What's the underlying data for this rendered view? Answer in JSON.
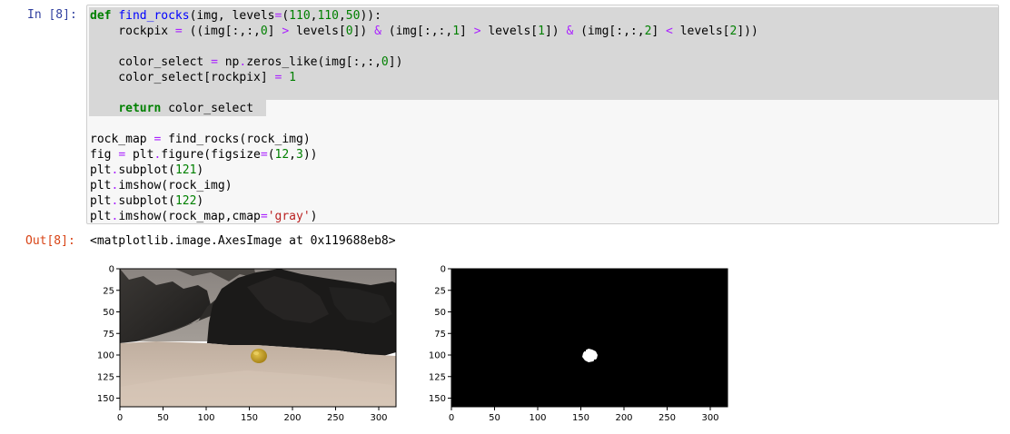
{
  "cell": {
    "in_prompt": "In [8]:",
    "out_prompt": "Out[8]:",
    "output_text": "<matplotlib.image.AxesImage at 0x119688eb8>"
  },
  "code": {
    "lines": [
      [
        [
          "kw",
          "def"
        ],
        [
          "",
          ""
        ],
        [
          "txt",
          " "
        ],
        [
          "nf",
          "find_rocks"
        ],
        [
          "txt",
          "(img, levels"
        ],
        [
          "op",
          "="
        ],
        [
          "txt",
          "("
        ],
        [
          "num",
          "110"
        ],
        [
          "txt",
          ","
        ],
        [
          "num",
          "110"
        ],
        [
          "txt",
          ","
        ],
        [
          "num",
          "50"
        ],
        [
          "txt",
          "))"
        ],
        [
          "txt",
          ":"
        ]
      ],
      [
        [
          "txt",
          "    rockpix "
        ],
        [
          "op",
          "="
        ],
        [
          "txt",
          " ((img[:,:,"
        ],
        [
          "num",
          "0"
        ],
        [
          "txt",
          "] "
        ],
        [
          "op",
          ">"
        ],
        [
          "txt",
          " levels["
        ],
        [
          "num",
          "0"
        ],
        [
          "txt",
          "]) "
        ],
        [
          "op",
          "&"
        ],
        [
          "txt",
          " (img[:,:,"
        ],
        [
          "num",
          "1"
        ],
        [
          "txt",
          "] "
        ],
        [
          "op",
          ">"
        ],
        [
          "txt",
          " levels["
        ],
        [
          "num",
          "1"
        ],
        [
          "txt",
          "]) "
        ],
        [
          "op",
          "&"
        ],
        [
          "txt",
          " (img[:,:,"
        ],
        [
          "num",
          "2"
        ],
        [
          "txt",
          "] "
        ],
        [
          "op",
          "<"
        ],
        [
          "txt",
          " levels["
        ],
        [
          "num",
          "2"
        ],
        [
          "txt",
          "]))"
        ]
      ],
      [
        [
          "txt",
          ""
        ]
      ],
      [
        [
          "txt",
          "    color_select "
        ],
        [
          "op",
          "="
        ],
        [
          "txt",
          " np"
        ],
        [
          "op",
          "."
        ],
        [
          "txt",
          "zeros_like(img[:,:,"
        ],
        [
          "num",
          "0"
        ],
        [
          "txt",
          "])"
        ]
      ],
      [
        [
          "txt",
          "    color_select[rockpix] "
        ],
        [
          "op",
          "="
        ],
        [
          "txt",
          " "
        ],
        [
          "num",
          "1"
        ]
      ],
      [
        [
          "txt",
          ""
        ]
      ],
      [
        [
          "txt",
          "    "
        ],
        [
          "kw",
          "return"
        ],
        [
          "txt",
          " color_select"
        ]
      ],
      [
        [
          "txt",
          ""
        ]
      ],
      [
        [
          "txt",
          "rock_map "
        ],
        [
          "op",
          "="
        ],
        [
          "txt",
          " find_rocks(rock_img)"
        ]
      ],
      [
        [
          "txt",
          "fig "
        ],
        [
          "op",
          "="
        ],
        [
          "txt",
          " plt"
        ],
        [
          "op",
          "."
        ],
        [
          "txt",
          "figure(figsize"
        ],
        [
          "op",
          "="
        ],
        [
          "txt",
          "("
        ],
        [
          "num",
          "12"
        ],
        [
          "txt",
          ","
        ],
        [
          "num",
          "3"
        ],
        [
          "txt",
          "))"
        ]
      ],
      [
        [
          "txt",
          "plt"
        ],
        [
          "op",
          "."
        ],
        [
          "txt",
          "subplot("
        ],
        [
          "num",
          "121"
        ],
        [
          "txt",
          ")"
        ]
      ],
      [
        [
          "txt",
          "plt"
        ],
        [
          "op",
          "."
        ],
        [
          "txt",
          "imshow(rock_img)"
        ]
      ],
      [
        [
          "txt",
          "plt"
        ],
        [
          "op",
          "."
        ],
        [
          "txt",
          "subplot("
        ],
        [
          "num",
          "122"
        ],
        [
          "txt",
          ")"
        ]
      ],
      [
        [
          "txt",
          "plt"
        ],
        [
          "op",
          "."
        ],
        [
          "txt",
          "imshow(rock_map,cmap"
        ],
        [
          "op",
          "="
        ],
        [
          "str",
          "'gray'"
        ],
        [
          "txt",
          ")"
        ]
      ]
    ]
  },
  "figure": {
    "axes": [
      {
        "name": "rock-image-axes",
        "xticks": [
          "0",
          "50",
          "100",
          "150",
          "200",
          "250",
          "300"
        ],
        "yticks": [
          "0",
          "25",
          "50",
          "75",
          "100",
          "125",
          "150"
        ],
        "xlim": [
          0,
          320
        ],
        "ylim": [
          160,
          0
        ]
      },
      {
        "name": "rock-map-axes",
        "xticks": [
          "0",
          "50",
          "100",
          "150",
          "200",
          "250",
          "300"
        ],
        "yticks": [
          "0",
          "25",
          "50",
          "75",
          "100",
          "125",
          "150"
        ],
        "xlim": [
          0,
          320
        ],
        "ylim": [
          160,
          0
        ]
      }
    ],
    "colors": {
      "prompt_in": "#303f9f",
      "prompt_out": "#d84315",
      "keyword": "#008000",
      "function": "#0000ff",
      "number": "#008000",
      "operator": "#aa22ff",
      "string": "#ba2121",
      "sand": "#c9b6a6",
      "rock": "#c9a530"
    }
  }
}
